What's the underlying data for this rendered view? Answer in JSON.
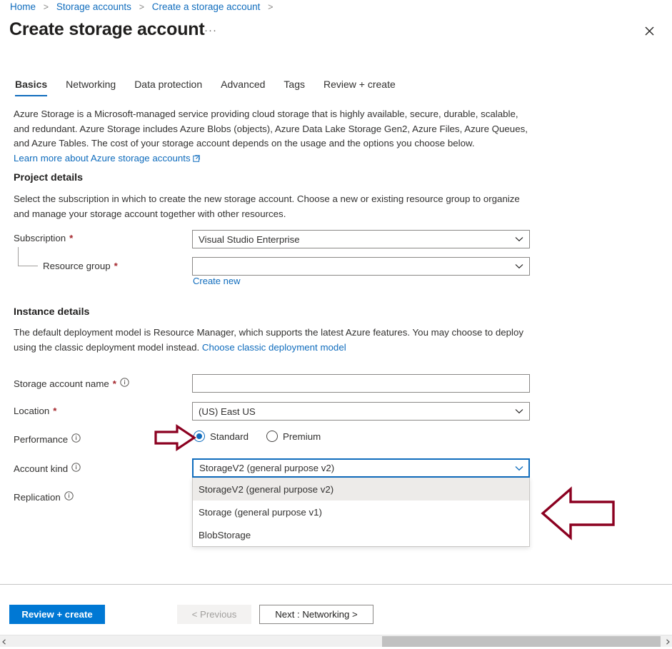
{
  "breadcrumb": {
    "items": [
      "Home",
      "Storage accounts",
      "Create a storage account"
    ],
    "separator": ">"
  },
  "header": {
    "title": "Create storage account",
    "more_menu": "···",
    "close_icon": "close-icon"
  },
  "tabs": [
    {
      "label": "Basics",
      "active": true
    },
    {
      "label": "Networking",
      "active": false
    },
    {
      "label": "Data protection",
      "active": false
    },
    {
      "label": "Advanced",
      "active": false
    },
    {
      "label": "Tags",
      "active": false
    },
    {
      "label": "Review + create",
      "active": false
    }
  ],
  "intro": {
    "paragraph": "Azure Storage is a Microsoft-managed service providing cloud storage that is highly available, secure, durable, scalable, and redundant. Azure Storage includes Azure Blobs (objects), Azure Data Lake Storage Gen2, Azure Files, Azure Queues, and Azure Tables. The cost of your storage account depends on the usage and the options you choose below.",
    "link": "Learn more about Azure storage accounts"
  },
  "project_details": {
    "heading": "Project details",
    "description": "Select the subscription in which to create the new storage account. Choose a new or existing resource group to organize and manage your storage account together with other resources.",
    "subscription": {
      "label": "Subscription",
      "required": "*",
      "value": "Visual Studio Enterprise"
    },
    "resource_group": {
      "label": "Resource group",
      "required": "*",
      "value": "",
      "create_new": "Create new"
    }
  },
  "instance_details": {
    "heading": "Instance details",
    "description": "The default deployment model is Resource Manager, which supports the latest Azure features. You may choose to deploy using the classic deployment model instead.",
    "classic_link": "Choose classic deployment model",
    "storage_account_name": {
      "label": "Storage account name",
      "required": "*",
      "value": "",
      "placeholder": "",
      "info_icon": "info-icon"
    },
    "location": {
      "label": "Location",
      "required": "*",
      "value": "(US) East US"
    },
    "performance": {
      "label": "Performance",
      "info_icon": "info-icon",
      "options": [
        {
          "label": "Standard",
          "selected": true
        },
        {
          "label": "Premium",
          "selected": false
        }
      ]
    },
    "account_kind": {
      "label": "Account kind",
      "info_icon": "info-icon",
      "value": "StorageV2 (general purpose v2)",
      "expanded": true,
      "options": [
        {
          "label": "StorageV2 (general purpose v2)",
          "selected": true
        },
        {
          "label": "Storage (general purpose v1)",
          "selected": false
        },
        {
          "label": "BlobStorage",
          "selected": false
        }
      ]
    },
    "replication": {
      "label": "Replication",
      "info_icon": "info-icon"
    }
  },
  "annotations": [
    {
      "name": "arrow-right-performance",
      "direction": "right",
      "color": "#8B0020"
    },
    {
      "name": "arrow-left-account-kind",
      "direction": "left",
      "color": "#8B0020"
    }
  ],
  "footer": {
    "review_create": "Review + create",
    "previous": "< Previous",
    "next": "Next : Networking >"
  },
  "colors": {
    "accent": "#0f6cbd",
    "primary_button": "#0078d4",
    "required_asterisk": "#a4262c",
    "annotation": "#8B0020",
    "option_highlight": "#edebe9"
  }
}
